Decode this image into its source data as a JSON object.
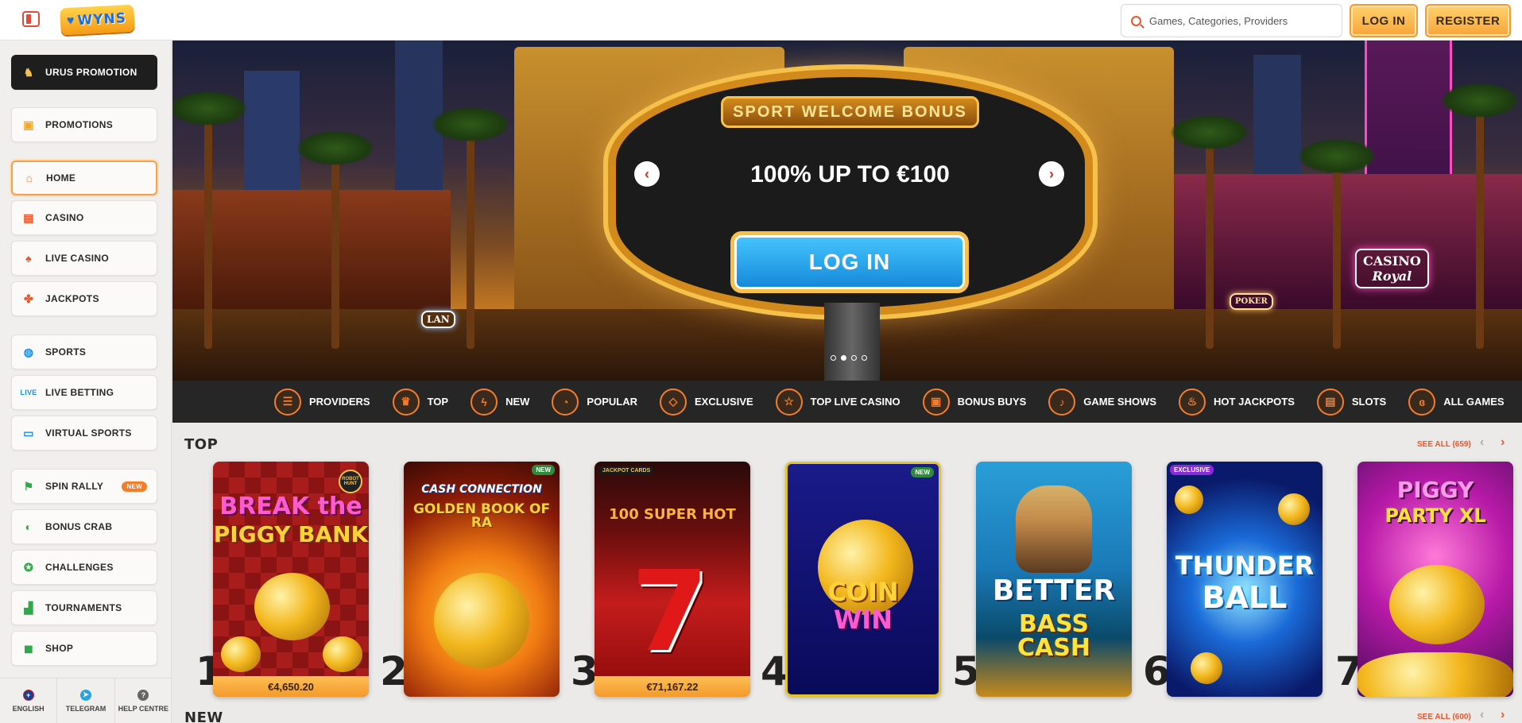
{
  "header": {
    "logo_text": "WYNS",
    "search_placeholder": "Games, Categories, Providers",
    "login_label": "LOG IN",
    "register_label": "REGISTER"
  },
  "sidebar": {
    "items": [
      {
        "label": "URUS PROMOTION"
      },
      {
        "label": "PROMOTIONS"
      },
      {
        "label": "HOME"
      },
      {
        "label": "CASINO"
      },
      {
        "label": "LIVE CASINO"
      },
      {
        "label": "JACKPOTS"
      },
      {
        "label": "SPORTS"
      },
      {
        "label": "LIVE BETTING"
      },
      {
        "label": "VIRTUAL SPORTS"
      },
      {
        "label": "SPIN RALLY",
        "badge": "NEW"
      },
      {
        "label": "BONUS CRAB"
      },
      {
        "label": "CHALLENGES"
      },
      {
        "label": "TOURNAMENTS"
      },
      {
        "label": "SHOP"
      }
    ],
    "footer": [
      {
        "label": "ENGLISH"
      },
      {
        "label": "TELEGRAM"
      },
      {
        "label": "HELP CENTRE"
      }
    ]
  },
  "banner": {
    "title": "SPORT WELCOME BONUS",
    "headline": "100% UP TO €100",
    "cta": "LOG IN",
    "prev": "‹",
    "next": "›",
    "slide_count": 4,
    "active_slide": 2,
    "casino_sign_1": "CASINO",
    "casino_sign_2": "Royal",
    "lan_sign": "LAN",
    "poker_sign": "POKER"
  },
  "categories": [
    {
      "label": "PROVIDERS",
      "icon": "list-icon"
    },
    {
      "label": "TOP",
      "icon": "crown-icon"
    },
    {
      "label": "NEW",
      "icon": "lightning-icon"
    },
    {
      "label": "POPULAR",
      "icon": "fire-icon"
    },
    {
      "label": "EXCLUSIVE",
      "icon": "diamond-icon"
    },
    {
      "label": "TOP LIVE CASINO",
      "icon": "star-icon"
    },
    {
      "label": "BONUS BUYS",
      "icon": "gift-icon"
    },
    {
      "label": "GAME SHOWS",
      "icon": "mic-icon"
    },
    {
      "label": "HOT JACKPOTS",
      "icon": "hot-pot-icon"
    },
    {
      "label": "SLOTS",
      "icon": "slot-icon"
    },
    {
      "label": "ALL GAMES",
      "icon": "cherry-icon"
    }
  ],
  "top_section": {
    "title": "TOP",
    "see_all": "SEE ALL (659)",
    "prev": "‹",
    "next": "›",
    "games": [
      {
        "rank": "1",
        "title_1": "BREAK the",
        "title_2": "PIGGY BANK",
        "jackpot": "€4,650.20",
        "badge": "",
        "logo": "ROBOT HUNT"
      },
      {
        "rank": "2",
        "title_1": "CASH CONNECTION",
        "title_2": "GOLDEN BOOK OF RA",
        "jackpot": "",
        "badge": "NEW"
      },
      {
        "rank": "3",
        "title_1": "100 SUPER HOT",
        "title_2": "",
        "jackpot": "€71,167.22",
        "badge": "",
        "logo": "JACKPOT CARDS"
      },
      {
        "rank": "4",
        "title_1": "COIN",
        "title_2": "WIN",
        "jackpot": "",
        "badge": "NEW"
      },
      {
        "rank": "5",
        "title_1": "BETTER",
        "title_2": "BASS CASH",
        "jackpot": "",
        "badge": ""
      },
      {
        "rank": "6",
        "title_1": "THUNDER",
        "title_2": "BALL",
        "jackpot": "",
        "badge": "EXCLUSIVE"
      },
      {
        "rank": "7",
        "title_1": "PIGGY",
        "title_2": "PARTY XL",
        "jackpot": "",
        "badge": ""
      }
    ]
  },
  "new_section": {
    "title": "NEW",
    "see_all": "SEE ALL (600)"
  },
  "colors": {
    "accent": "#f57d2a",
    "sidebar_bg": "#f1efed",
    "category_bar": "#262626"
  }
}
